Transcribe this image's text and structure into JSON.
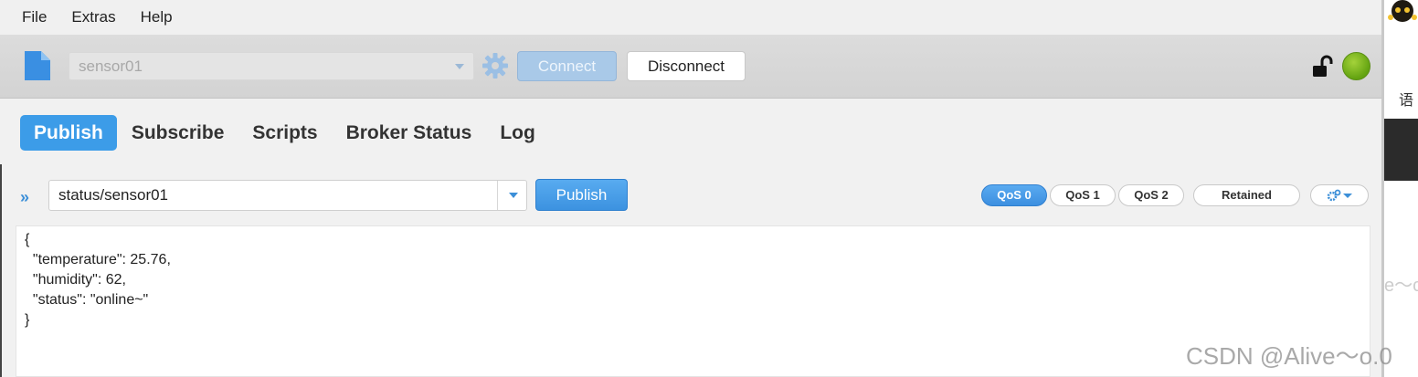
{
  "menu": {
    "items": [
      "File",
      "Extras",
      "Help"
    ]
  },
  "toolbar": {
    "connection_profile": "sensor01",
    "connect_label": "Connect",
    "disconnect_label": "Disconnect",
    "status_color": "#6aaa16"
  },
  "tabs": [
    {
      "label": "Publish",
      "active": true
    },
    {
      "label": "Subscribe",
      "active": false
    },
    {
      "label": "Scripts",
      "active": false
    },
    {
      "label": "Broker Status",
      "active": false
    },
    {
      "label": "Log",
      "active": false
    }
  ],
  "publish": {
    "topic": "status/sensor01",
    "publish_label": "Publish",
    "qos0": "QoS 0",
    "qos1": "QoS 1",
    "qos2": "QoS 2",
    "selected_qos": "QoS 0",
    "retained_label": "Retained",
    "payload": "{\n  \"temperature\": 25.76,\n  \"humidity\": 62,\n  \"status\": \"online~\"\n}"
  },
  "outside": {
    "cjk_text": "语",
    "tilde_text": "e～c"
  },
  "watermark": "CSDN @Alive～o.0",
  "colors": {
    "accent": "#3c9ce8",
    "connect_disabled": "#a9c9e8"
  }
}
